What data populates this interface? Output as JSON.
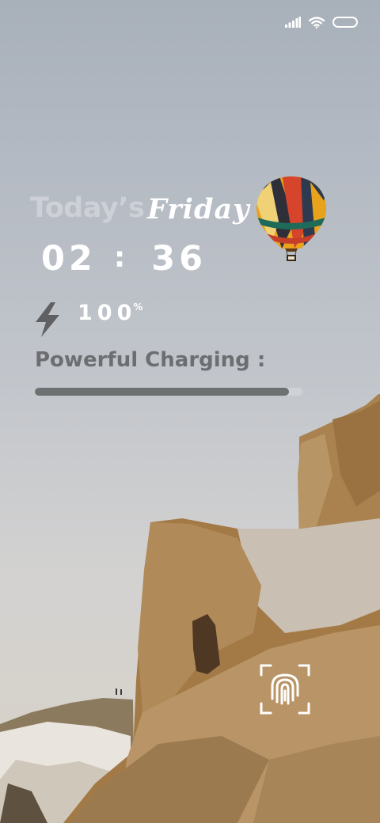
{
  "status_bar": {
    "icons": [
      "signal-icon",
      "wifi-icon",
      "battery-icon"
    ]
  },
  "lock_screen": {
    "greeting": "Today’s",
    "day": "Friday",
    "time": {
      "hours": "02",
      "separator": ":",
      "minutes": "36"
    },
    "battery": {
      "level": "100",
      "unit": "%",
      "fraction": 1.0
    },
    "charging_label": "Powerful Charging :",
    "charging_progress": 0.95
  },
  "colors": {
    "accent_gray": "#6d6e71",
    "text_white": "#ffffff",
    "faded_text": "#cdd0d6"
  },
  "icons": {
    "charge": "lightning-bolt-icon",
    "unlock": "fingerprint-icon",
    "decoration": "hot-air-balloon-icon"
  }
}
